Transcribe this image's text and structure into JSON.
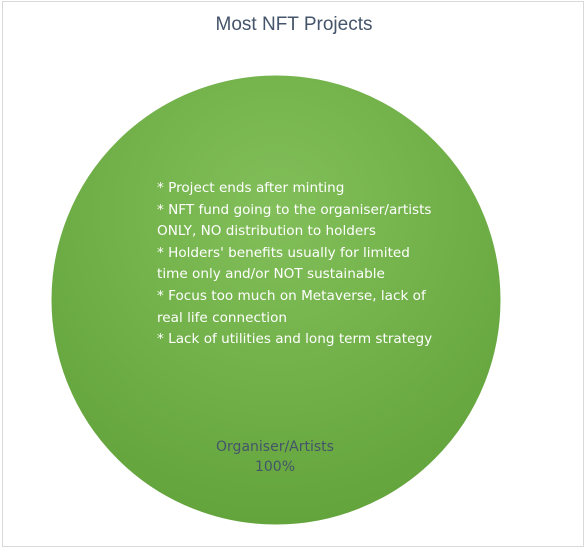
{
  "chart_data": {
    "type": "pie",
    "title": "Most NFT Projects",
    "categories": [
      "Organiser/Artists"
    ],
    "values": [
      100
    ],
    "data_labels": [
      {
        "category": "Organiser/Artists",
        "percent": "100%"
      }
    ],
    "colors": [
      "#70ad47"
    ],
    "annotation_lines": [
      "* Project ends after minting",
      "* NFT fund going to the organiser/artists",
      "ONLY, NO distribution to holders",
      "* Holders' benefits usually for limited",
      "time only and/or NOT sustainable",
      "* Focus too much on Metaverse, lack of",
      "real life connection",
      "* Lack of utilities and long term strategy"
    ],
    "legend": "none"
  }
}
